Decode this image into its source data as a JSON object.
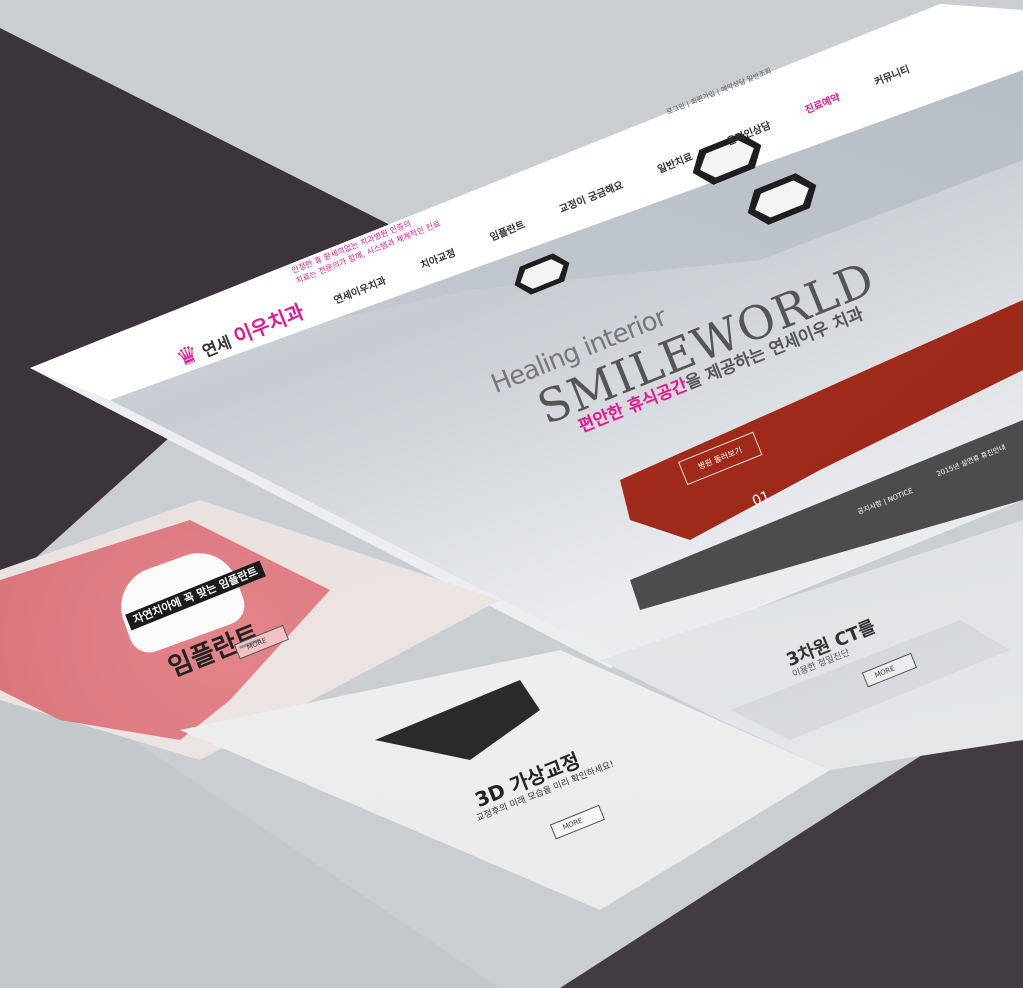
{
  "header": {
    "logo_small": "연세",
    "logo_main": "이우치과",
    "slogan_line1": "안정한 휴 환세의없는 치과병원 인증의",
    "slogan_line2": "치료는 전문의가 함께, 시스템과 체계적인 진료",
    "util_links": [
      "로그인",
      "회원가입",
      "예약상담 일반조회"
    ]
  },
  "nav": [
    "연세이우치과",
    "치아교정",
    "임플란트",
    "교정이 궁금해요",
    "일반치료",
    "온라인상담",
    "진료예약",
    "커뮤니티"
  ],
  "nav_active_index": 6,
  "hero": {
    "tagline_en": "Healing interior",
    "title_en": "SMILEWORLD",
    "desc_pink": "편안한 휴식공간",
    "desc_rest": "을 제공하는 연세이우 치과",
    "button": "병원 둘러보기",
    "slide": "01",
    "notice_label": "공지사항 | NOTICE",
    "notice_text": "2015년 설연휴 휴진안내"
  },
  "implant": {
    "banner": "자연치아에 꼭 맞는 임플란트",
    "title": "임플란트",
    "more": "MORE"
  },
  "ortho": {
    "title": "3D 가상교정",
    "sub": "교정후의 미래 모습을 미리 확인하세요!",
    "more": "MORE"
  },
  "ct": {
    "title": "3차원 CT를",
    "sub": "이용한 정밀진단",
    "more": "MORE"
  },
  "colors": {
    "accent": "#e2188e",
    "dark": "#3b343c"
  }
}
